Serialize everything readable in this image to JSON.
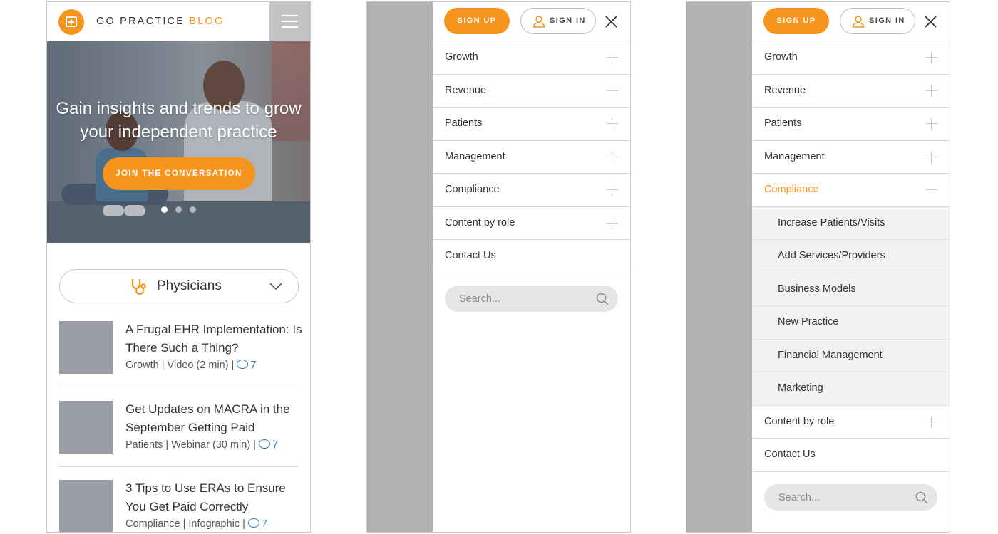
{
  "header": {
    "brand_part1": "GO PRACTICE",
    "brand_part2": "BLOG"
  },
  "hero": {
    "headline": "Gain insights and trends to grow your independent practice",
    "cta_label": "JOIN THE CONVERSATION",
    "slides_count": 3,
    "active_slide": 1
  },
  "role_selector": {
    "selected": "Physicians"
  },
  "articles": [
    {
      "title": "A Frugal EHR Implementation: Is There Such a Thing?",
      "meta": "Growth | Video (2 min) |",
      "comments": "7"
    },
    {
      "title": "Get Updates on MACRA in the September Getting Paid",
      "meta": "Patients | Webinar (30 min) |",
      "comments": "7"
    },
    {
      "title": "3 Tips to Use ERAs to Ensure You Get Paid Correctly",
      "meta": "Compliance | Infographic |",
      "comments": "7"
    }
  ],
  "menu": {
    "signup_label": "SIGN UP",
    "signin_label": "SIGN IN",
    "items": [
      "Growth",
      "Revenue",
      "Patients",
      "Management",
      "Compliance",
      "Content by role",
      "Contact Us"
    ],
    "expanded_item": "Compliance",
    "sub_items": [
      "Increase Patients/Visits",
      "Add Services/Providers",
      "Business Models",
      "New Practice",
      "Financial Management",
      "Marketing"
    ],
    "search_placeholder": "Search..."
  },
  "colors": {
    "accent": "#f7941d",
    "comment_link": "#2a7ab8",
    "thumbnail": "#9a9ca6",
    "overlay": "#c3c3c3"
  }
}
